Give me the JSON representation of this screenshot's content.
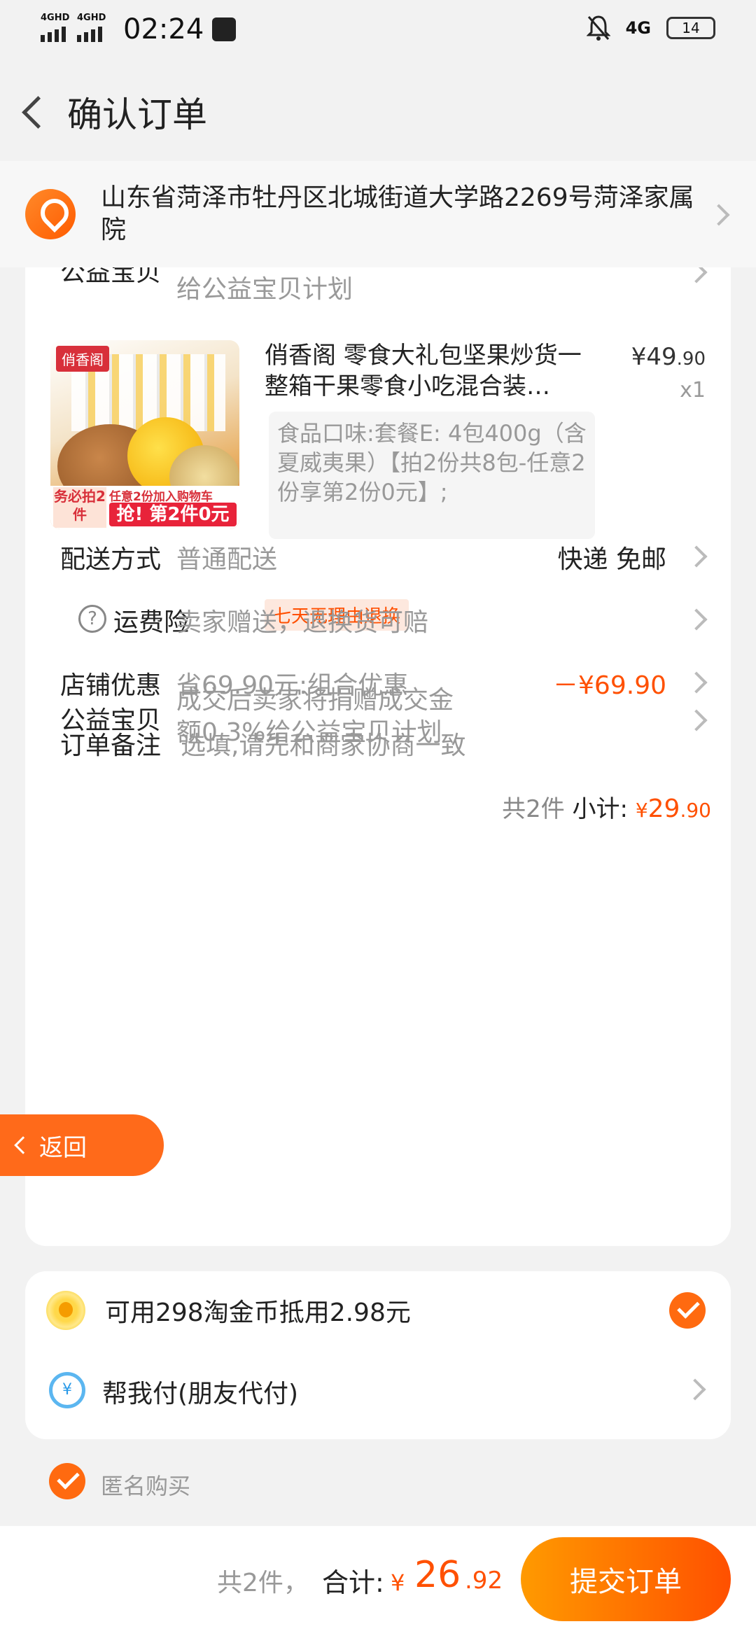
{
  "status": {
    "signal1": "4GHD",
    "signal2": "4GHD",
    "time": "02:24",
    "network": "4G",
    "battery": "14"
  },
  "header": {
    "title": "确认订单"
  },
  "address": {
    "text": "山东省菏泽市牡丹区北城街道大学路2269号菏泽家属院"
  },
  "top_partial": {
    "label": "公益宝贝",
    "value": "给公益宝贝计划"
  },
  "product": {
    "image_brand": "俏香阁",
    "image_must": "务必拍2件",
    "image_promo_top": "任意2份加入购物车",
    "image_promo": "抢! 第2件0元",
    "title": "俏香阁 零食大礼包坚果炒货一整箱干果零食小吃混合装…",
    "price_int": "¥49",
    "price_dec": ".90",
    "qty": "x1",
    "spec": "食品口味:套餐E: 4包400g（含夏威夷果）【拍2份共8包-任意2份享第2份0元】;",
    "return_tag": "七天无理由退换"
  },
  "rows": {
    "charity_label": "公益宝贝",
    "charity_value": "成交后卖家将捐赠成交金额0.3%给公益宝贝计划",
    "delivery_label": "配送方式",
    "delivery_value": "普通配送",
    "delivery_right": "快递 免邮",
    "insurance_label": "运费险",
    "insurance_value": "卖家赠送，退换货可赔",
    "discount_label": "店铺优惠",
    "discount_value": "省69.90元:组合优惠",
    "discount_amount": "－¥69.90",
    "note_label": "订单备注",
    "note_placeholder": "选填,请先和商家协商一致"
  },
  "subtotal": {
    "count": "共2件",
    "label": "小计:",
    "rmb": "¥",
    "amount": "29",
    "dec": ".90"
  },
  "float_back": {
    "label": "返回"
  },
  "coins": {
    "label": "可用298淘金币抵用2.98元"
  },
  "friend_pay": {
    "label": "帮我付(朋友代付)",
    "icon_text": "¥"
  },
  "anonymous": {
    "label": "匿名购买"
  },
  "bottom": {
    "count": "共2件，",
    "sum_label": "合计:",
    "rmb": "¥",
    "amount": "26",
    "dec": ".92",
    "submit": "提交订单"
  },
  "colors": {
    "accent": "#ff5000",
    "button_start": "#ff9a00",
    "button_end": "#ff5000"
  }
}
